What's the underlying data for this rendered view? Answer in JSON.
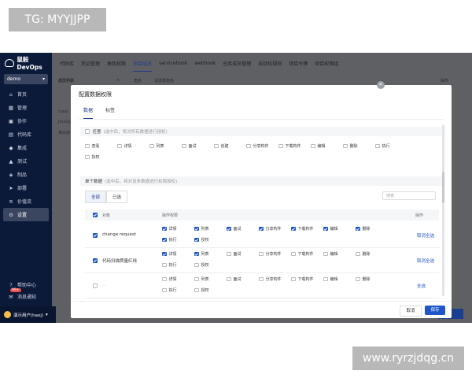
{
  "watermark_top": "TG: MYYJJPP",
  "watermark_bottom": "www.ryrzjdqg.cn",
  "app": {
    "logo": "鼠毅DevOps",
    "project": "demo"
  },
  "sidebar": {
    "items": [
      {
        "label": "首页",
        "icon": "home-icon",
        "glyph": "⌂"
      },
      {
        "label": "管理",
        "icon": "grid-icon",
        "glyph": "▦"
      },
      {
        "label": "协作",
        "icon": "collab-icon",
        "glyph": "▣"
      },
      {
        "label": "代码库",
        "icon": "code-icon",
        "glyph": "▤"
      },
      {
        "label": "集成",
        "icon": "integrate-icon",
        "glyph": "◆"
      },
      {
        "label": "测试",
        "icon": "test-icon",
        "glyph": "▲"
      },
      {
        "label": "制品",
        "icon": "package-icon",
        "glyph": "◈"
      },
      {
        "label": "部署",
        "icon": "deploy-icon",
        "glyph": "➤"
      },
      {
        "label": "价值流",
        "icon": "flow-icon",
        "glyph": "≋"
      },
      {
        "label": "设置",
        "icon": "gear-icon",
        "glyph": "⚙"
      }
    ],
    "help": "帮助中心",
    "notify": "消息通知",
    "notify_badge": "99+",
    "user": "演示用户(haoj)"
  },
  "topnav": [
    "代码库",
    "凭证管理",
    "角色权限",
    "项目成员",
    "servicehook",
    "webhook",
    "仓库成员管理",
    "自动化规则",
    "项目令牌",
    "项目权限组"
  ],
  "background": {
    "list_title": "成员列表",
    "role_label": "角色",
    "role_placeholder": "请选择角色",
    "col1": "creat",
    "col2": "jmx(oj",
    "col3": "演示用",
    "col_right": "操作"
  },
  "modal": {
    "title": "配置数据权限",
    "tabs": [
      "数据",
      "标签"
    ],
    "any_title": "任意",
    "any_hint": "(选中后，将对所有数据进行授权)",
    "any_perms": [
      "查看",
      "详情",
      "列表",
      "面试",
      "创建",
      "分享构件",
      "下载构件",
      "编辑",
      "删除",
      "执行",
      "授权"
    ],
    "single_title": "单个数据",
    "single_hint": "(选中后，将对该条数据进行权限授权)",
    "filter_tabs": [
      "全部",
      "已选"
    ],
    "search_placeholder": "搜索",
    "col_object": "对象",
    "col_perm": "操作权限",
    "col_action": "操作",
    "rows": [
      {
        "name": "change request",
        "perms": [
          "详情",
          "列表",
          "面试",
          "分享构件",
          "下载构件",
          "编辑",
          "删除",
          "执行",
          "授权"
        ],
        "checked": [
          true,
          true,
          true,
          true,
          true,
          true,
          true,
          true,
          true
        ],
        "row_checked": true,
        "action": "取消全选"
      },
      {
        "name": "代码扫描质量红线",
        "perms": [
          "详情",
          "列表",
          "面试",
          "分享构件",
          "下载构件",
          "编辑",
          "删除",
          "执行",
          "授权"
        ],
        "checked": [
          true,
          true,
          false,
          false,
          false,
          false,
          false,
          false,
          false
        ],
        "row_checked": true,
        "action": "取消全选"
      },
      {
        "name": "...",
        "perms": [
          "详情",
          "列表",
          "面试",
          "分享构件",
          "下载构件",
          "编辑",
          "删除",
          "执行",
          "授权"
        ],
        "checked": [
          false,
          false,
          false,
          false,
          false,
          false,
          false,
          false,
          false
        ],
        "row_checked": false,
        "action": "全选"
      }
    ],
    "cancel": "取消",
    "save": "保存"
  }
}
